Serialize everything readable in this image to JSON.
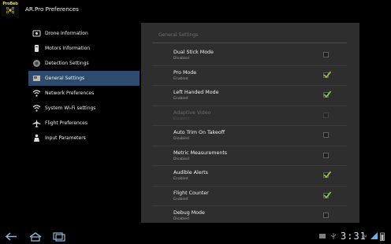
{
  "app": {
    "icon_text": "ProBeb",
    "title": "AR.Pro Preferences"
  },
  "left_menu": [
    {
      "label": "Drone Information",
      "icon": "drone-info-icon",
      "selected": false
    },
    {
      "label": "Motors Information",
      "icon": "motor-icon",
      "selected": false
    },
    {
      "label": "Detection Settings",
      "icon": "detection-icon",
      "selected": false
    },
    {
      "label": "General Settings",
      "icon": "general-settings-icon",
      "selected": true
    },
    {
      "label": "Network Preferences",
      "icon": "wifi-icon",
      "selected": false
    },
    {
      "label": "System Wi-Fi settings",
      "icon": "system-wifi-icon",
      "selected": false
    },
    {
      "label": "Flight Preferences",
      "icon": "airplane-icon",
      "selected": false
    },
    {
      "label": "Input Parameters",
      "icon": "person-icon",
      "selected": false
    }
  ],
  "panel": {
    "header": "General Settings",
    "prefs": [
      {
        "title": "Dual Stick Mode",
        "summary": "Disabled",
        "checked": false,
        "enabled": true
      },
      {
        "title": "Pro Mode",
        "summary": "Enabled",
        "checked": true,
        "enabled": true
      },
      {
        "title": "Left Handed Mode",
        "summary": "Enabled",
        "checked": true,
        "enabled": true
      },
      {
        "title": "Adaptive Video",
        "summary": "Disabled",
        "checked": false,
        "enabled": false
      },
      {
        "title": "Auto Trim On Takeoff",
        "summary": "Disabled",
        "checked": false,
        "enabled": true
      },
      {
        "title": "Metric Measurements",
        "summary": "Disabled",
        "checked": false,
        "enabled": true
      },
      {
        "title": "Audible Alerts",
        "summary": "Enabled",
        "checked": true,
        "enabled": true
      },
      {
        "title": "Flight Counter",
        "summary": "Enabled",
        "checked": true,
        "enabled": true
      },
      {
        "title": "Debug Mode",
        "summary": "Disabled",
        "checked": false,
        "enabled": true
      }
    ]
  },
  "system_bar": {
    "time": "3:31",
    "ampm": "AM"
  },
  "colors": {
    "selected_bg": "#2c4b6d",
    "check_green": "#8bc34a",
    "panel_bg": "#2e2e2e"
  }
}
